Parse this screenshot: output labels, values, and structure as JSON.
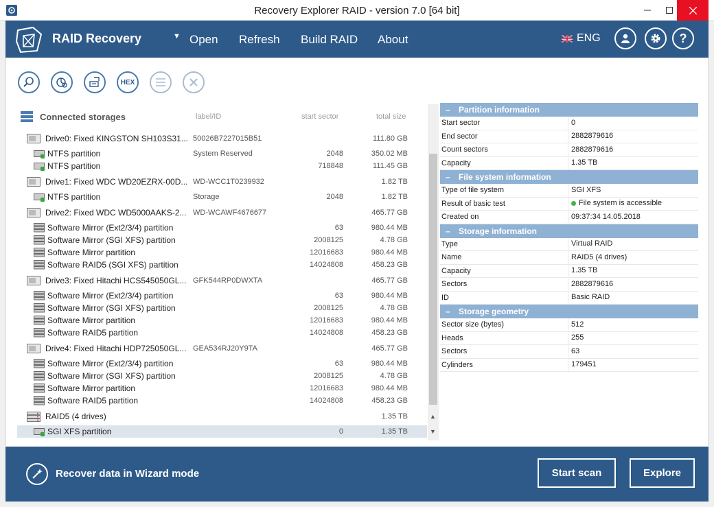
{
  "window": {
    "title": "Recovery Explorer RAID - version 7.0 [64 bit]"
  },
  "header": {
    "brand": "RAID Recovery",
    "menu": [
      "Open",
      "Refresh",
      "Build RAID",
      "About"
    ],
    "language": "ENG"
  },
  "toolbar": {
    "hex_label": "HEX"
  },
  "tree": {
    "title": "Connected storages",
    "col_label": "label/ID",
    "col_start": "start sector",
    "col_size": "total size",
    "rows": [
      {
        "type": "drive",
        "name": "Drive0: Fixed KINGSTON SH103S31...",
        "label": "50026B7227015B51",
        "start": "",
        "size": "111.80 GB"
      },
      {
        "type": "part",
        "name": "NTFS partition",
        "label": "System Reserved",
        "start": "2048",
        "size": "350.02 MB"
      },
      {
        "type": "part",
        "name": "NTFS partition",
        "label": "",
        "start": "718848",
        "size": "111.45 GB"
      },
      {
        "type": "drive",
        "name": "Drive1: Fixed WDC WD20EZRX-00D...",
        "label": "WD-WCC1T0239932",
        "start": "",
        "size": "1.82 TB"
      },
      {
        "type": "part",
        "name": "NTFS partition",
        "label": "Storage",
        "start": "2048",
        "size": "1.82 TB"
      },
      {
        "type": "drive",
        "name": "Drive2: Fixed WDC WD5000AAKS-2...",
        "label": "WD-WCAWF4676677",
        "start": "",
        "size": "465.77 GB"
      },
      {
        "type": "raidpart",
        "name": "Software Mirror (Ext2/3/4) partition",
        "label": "",
        "start": "63",
        "size": "980.44 MB"
      },
      {
        "type": "raidpart",
        "name": "Software Mirror (SGI XFS) partition",
        "label": "",
        "start": "2008125",
        "size": "4.78 GB"
      },
      {
        "type": "raidpart",
        "name": "Software Mirror partition",
        "label": "",
        "start": "12016683",
        "size": "980.44 MB"
      },
      {
        "type": "raidpart",
        "name": "Software RAID5 (SGI XFS) partition",
        "label": "",
        "start": "14024808",
        "size": "458.23 GB"
      },
      {
        "type": "drive",
        "name": "Drive3: Fixed Hitachi HCS545050GL...",
        "label": "GFK544RP0DWXTA",
        "start": "",
        "size": "465.77 GB"
      },
      {
        "type": "raidpart",
        "name": "Software Mirror (Ext2/3/4) partition",
        "label": "",
        "start": "63",
        "size": "980.44 MB"
      },
      {
        "type": "raidpart",
        "name": "Software Mirror (SGI XFS) partition",
        "label": "",
        "start": "2008125",
        "size": "4.78 GB"
      },
      {
        "type": "raidpart",
        "name": "Software Mirror partition",
        "label": "",
        "start": "12016683",
        "size": "980.44 MB"
      },
      {
        "type": "raidpart",
        "name": "Software RAID5 partition",
        "label": "",
        "start": "14024808",
        "size": "458.23 GB"
      },
      {
        "type": "drive",
        "name": "Drive4: Fixed Hitachi HDP725050GL...",
        "label": "GEA534RJ20Y9TA",
        "start": "",
        "size": "465.77 GB"
      },
      {
        "type": "raidpart",
        "name": "Software Mirror (Ext2/3/4) partition",
        "label": "",
        "start": "63",
        "size": "980.44 MB"
      },
      {
        "type": "raidpart",
        "name": "Software Mirror (SGI XFS) partition",
        "label": "",
        "start": "2008125",
        "size": "4.78 GB"
      },
      {
        "type": "raidpart",
        "name": "Software Mirror partition",
        "label": "",
        "start": "12016683",
        "size": "980.44 MB"
      },
      {
        "type": "raidpart",
        "name": "Software RAID5 partition",
        "label": "",
        "start": "14024808",
        "size": "458.23 GB"
      },
      {
        "type": "raid",
        "name": "RAID5 (4 drives)",
        "label": "",
        "start": "",
        "size": "1.35 TB"
      },
      {
        "type": "part",
        "name": "SGI XFS partition",
        "label": "",
        "start": "0",
        "size": "1.35 TB",
        "selected": true
      }
    ]
  },
  "info": {
    "sections": [
      {
        "title": "Partition information",
        "rows": [
          {
            "k": "Start sector",
            "v": "0"
          },
          {
            "k": "End sector",
            "v": "2882879616"
          },
          {
            "k": "Count sectors",
            "v": "2882879616"
          },
          {
            "k": "Capacity",
            "v": "1.35 TB"
          }
        ]
      },
      {
        "title": "File system information",
        "rows": [
          {
            "k": "Type of file system",
            "v": "SGI XFS"
          },
          {
            "k": "Result of basic test",
            "v": "File system is accessible",
            "status": true
          },
          {
            "k": "Created on",
            "v": "09:37:34 14.05.2018"
          }
        ]
      },
      {
        "title": "Storage information",
        "rows": [
          {
            "k": "Type",
            "v": "Virtual RAID"
          },
          {
            "k": "Name",
            "v": "RAID5 (4 drives)"
          },
          {
            "k": "Capacity",
            "v": "1.35 TB"
          },
          {
            "k": "Sectors",
            "v": "2882879616"
          },
          {
            "k": "ID",
            "v": "Basic RAID"
          }
        ]
      },
      {
        "title": "Storage geometry",
        "rows": [
          {
            "k": "Sector size (bytes)",
            "v": "512"
          },
          {
            "k": "Heads",
            "v": "255"
          },
          {
            "k": "Sectors",
            "v": "63"
          },
          {
            "k": "Cylinders",
            "v": "179451"
          }
        ]
      }
    ]
  },
  "footer": {
    "wizard": "Recover data in Wizard mode",
    "start_scan": "Start scan",
    "explore": "Explore"
  },
  "colors": {
    "header_bg": "#2e5a8a",
    "section_bg": "#8fb1d4",
    "accent": "#4a7ab0",
    "ok_green": "#45b34a",
    "close_red": "#e81123"
  }
}
